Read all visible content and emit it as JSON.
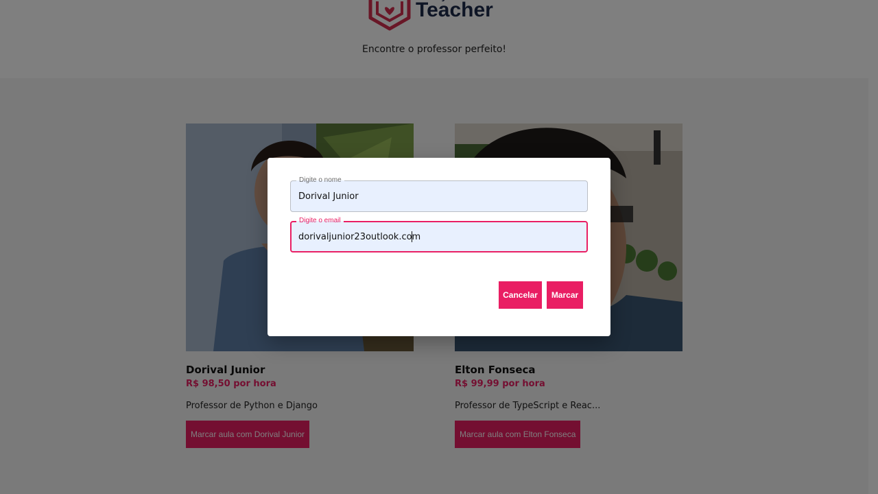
{
  "header": {
    "logo_small": "My",
    "logo_text": "Teacher",
    "tagline": "Encontre o professor perfeito!"
  },
  "teachers": [
    {
      "name": "Dorival Junior",
      "price": "R$ 98,50 por hora",
      "description": "Professor de Python e Django",
      "button_label": "Marcar aula com Dorival Junior"
    },
    {
      "name": "Elton Fonseca",
      "price": "R$ 99,99 por hora",
      "description": "Professor de TypeScript e Reac...",
      "button_label": "Marcar aula com Elton Fonseca"
    }
  ],
  "dialog": {
    "name_label": "Digite o nome",
    "name_value": "Dorival Junior",
    "email_label": "Digite o email",
    "email_value": "dorivaljunior23outlook.com",
    "cancel_label": "Cancelar",
    "submit_label": "Marcar"
  },
  "colors": {
    "accent": "#e91e63",
    "brand_dark": "#1c2a4a",
    "input_bg": "#e8f0fe"
  }
}
